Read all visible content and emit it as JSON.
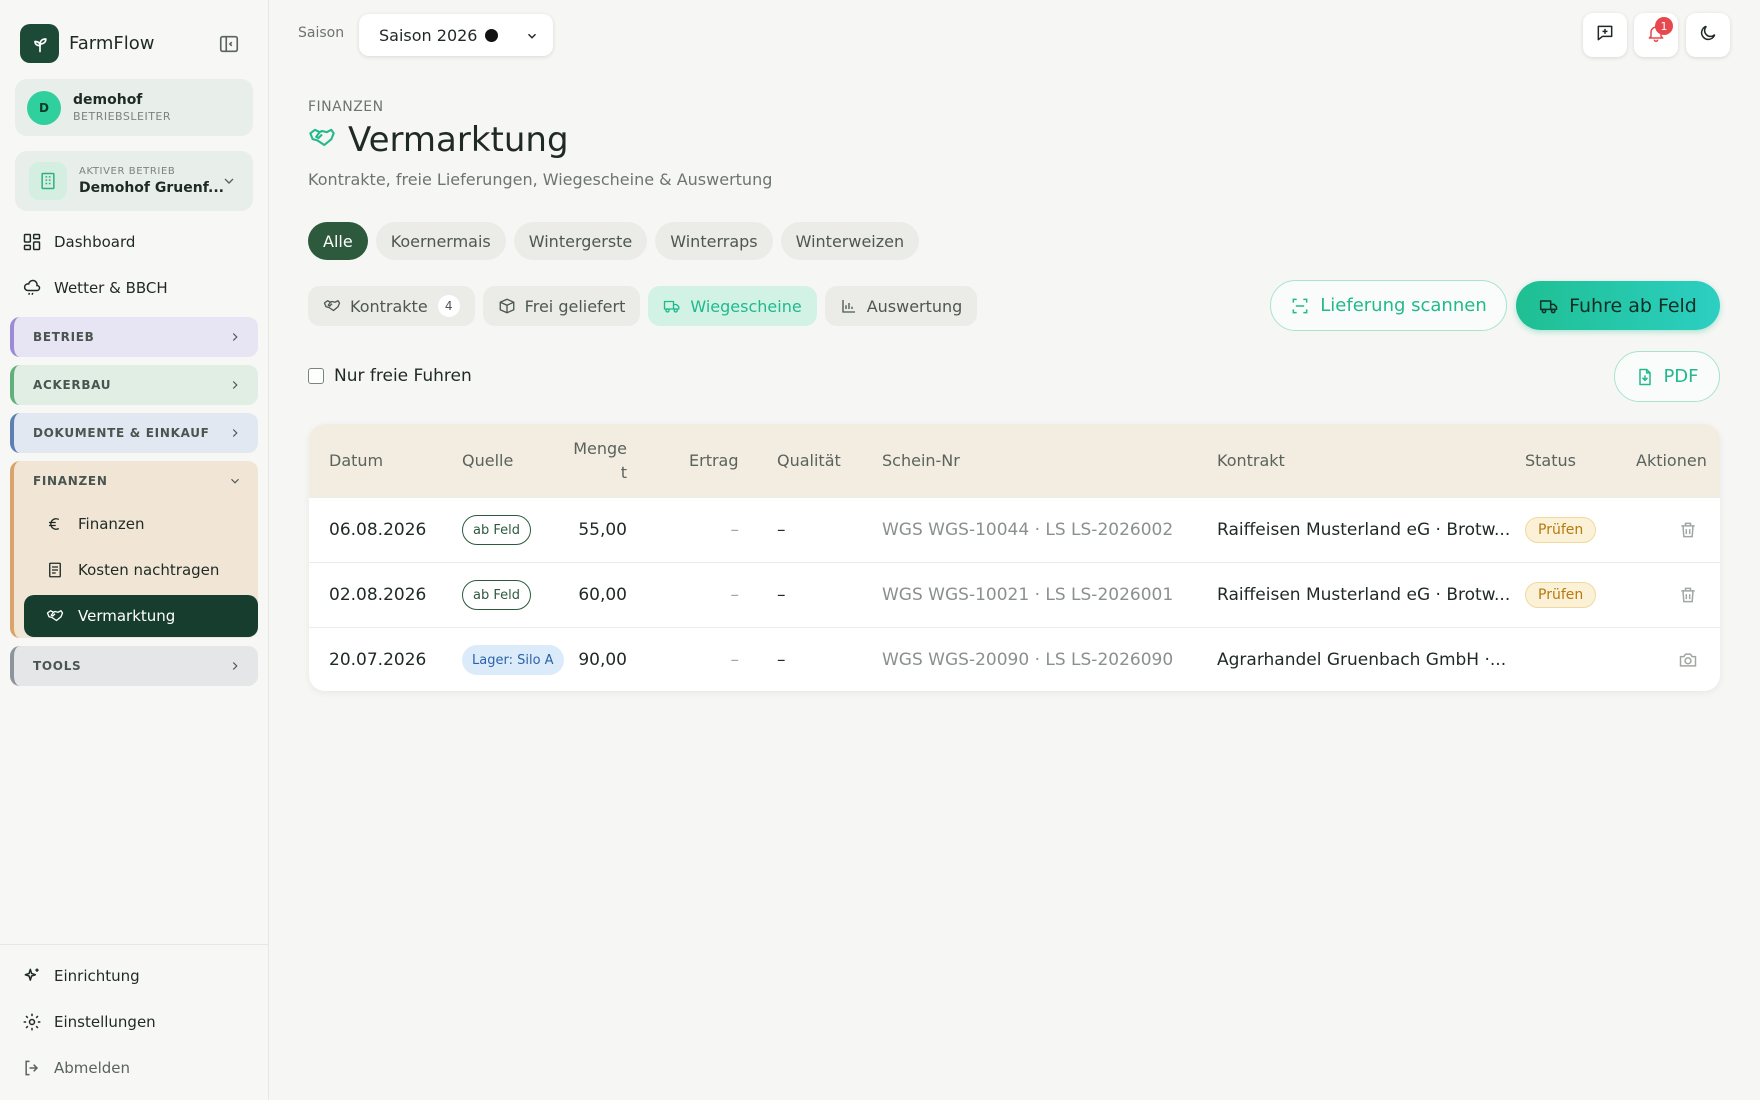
{
  "app": {
    "name": "FarmFlow"
  },
  "user": {
    "initial": "D",
    "name": "demohof",
    "role": "BETRIEBSLEITER"
  },
  "farm": {
    "label": "AKTIVER BETRIEB",
    "name": "Demohof Gruenf..."
  },
  "nav": {
    "dashboard": "Dashboard",
    "weather": "Wetter & BBCH"
  },
  "groups": {
    "betrieb": "BETRIEB",
    "ackerbau": "ACKERBAU",
    "dokumente": "DOKUMENTE & EINKAUF",
    "finanzen": "FINANZEN",
    "tools": "TOOLS"
  },
  "finanzen_items": [
    "Finanzen",
    "Kosten nachtragen",
    "Vermarktung"
  ],
  "footer": {
    "setup": "Einrichtung",
    "settings": "Einstellungen",
    "logout": "Abmelden"
  },
  "season": {
    "label": "Saison",
    "value": "Saison 2026"
  },
  "notifications": {
    "count": "1"
  },
  "header": {
    "crumb": "FINANZEN",
    "title": "Vermarktung",
    "subtitle": "Kontrakte, freie Lieferungen, Wiegescheine & Auswertung"
  },
  "crops": [
    "Alle",
    "Koernermais",
    "Wintergerste",
    "Winterraps",
    "Winterweizen"
  ],
  "tabs": {
    "kontrakte": "Kontrakte",
    "kontrakte_count": "4",
    "frei": "Frei geliefert",
    "wiegescheine": "Wiegescheine",
    "auswertung": "Auswertung"
  },
  "actions": {
    "scan": "Lieferung scannen",
    "fuhre": "Fuhre ab Feld",
    "pdf": "PDF"
  },
  "filter": {
    "only_free": "Nur freie Fuhren"
  },
  "table": {
    "headers": {
      "datum": "Datum",
      "quelle": "Quelle",
      "menge_line1": "Menge",
      "menge_line2": "t",
      "ertrag": "Ertrag",
      "qualitaet": "Qualität",
      "schein": "Schein-Nr",
      "kontrakt": "Kontrakt",
      "status": "Status",
      "aktionen": "Aktionen"
    },
    "rows": [
      {
        "datum": "06.08.2026",
        "quelle": "ab Feld",
        "menge": "55,00",
        "ertrag": "–",
        "qualitaet": "–",
        "schein": "WGS WGS-10044 · LS LS-2026002",
        "kontrakt": "Raiffeisen Musterland eG · Brotw...",
        "status": "Prüfen",
        "action_icon": "trash-icon"
      },
      {
        "datum": "02.08.2026",
        "quelle": "ab Feld",
        "menge": "60,00",
        "ertrag": "–",
        "qualitaet": "–",
        "schein": "WGS WGS-10021 · LS LS-2026001",
        "kontrakt": "Raiffeisen Musterland eG · Brotw...",
        "status": "Prüfen",
        "action_icon": "trash-icon"
      },
      {
        "datum": "20.07.2026",
        "quelle": "Lager: Silo A",
        "menge": "90,00",
        "ertrag": "–",
        "qualitaet": "–",
        "schein": "WGS WGS-20090 · LS LS-2026090",
        "kontrakt": "Agrarhandel Gruenbach GmbH ·...",
        "status": "",
        "action_icon": "camera-icon"
      }
    ]
  },
  "colors": {
    "accent": "#1fbf92",
    "dark_green": "#163d2e",
    "warning": "#b7790e"
  }
}
